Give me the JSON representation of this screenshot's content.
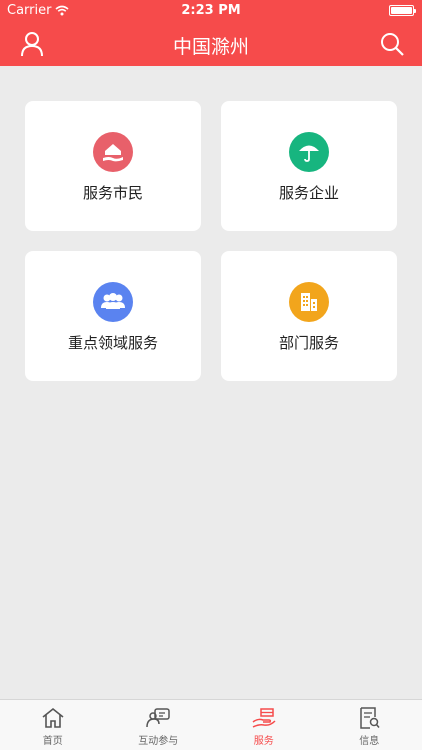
{
  "status_bar": {
    "carrier": "Carrier",
    "time": "2:23 PM"
  },
  "nav": {
    "title": "中国滁州",
    "left_icon": "user-icon",
    "right_icon": "search-icon"
  },
  "cards": [
    {
      "label": "服务市民",
      "icon": "house-hand-icon",
      "color": "#e8606a"
    },
    {
      "label": "服务企业",
      "icon": "umbrella-icon",
      "color": "#17b57f"
    },
    {
      "label": "重点领域服务",
      "icon": "people-icon",
      "color": "#5a83f0"
    },
    {
      "label": "部门服务",
      "icon": "building-icon",
      "color": "#f2a51c"
    }
  ],
  "tabs": [
    {
      "label": "首页",
      "icon": "home-icon",
      "active": false
    },
    {
      "label": "互动参与",
      "icon": "chat-icon",
      "active": false
    },
    {
      "label": "服务",
      "icon": "service-icon",
      "active": true
    },
    {
      "label": "信息",
      "icon": "info-doc-icon",
      "active": false
    }
  ],
  "colors": {
    "brand": "#f64b4b",
    "background": "#ebebeb",
    "tab_inactive": "#666666"
  }
}
